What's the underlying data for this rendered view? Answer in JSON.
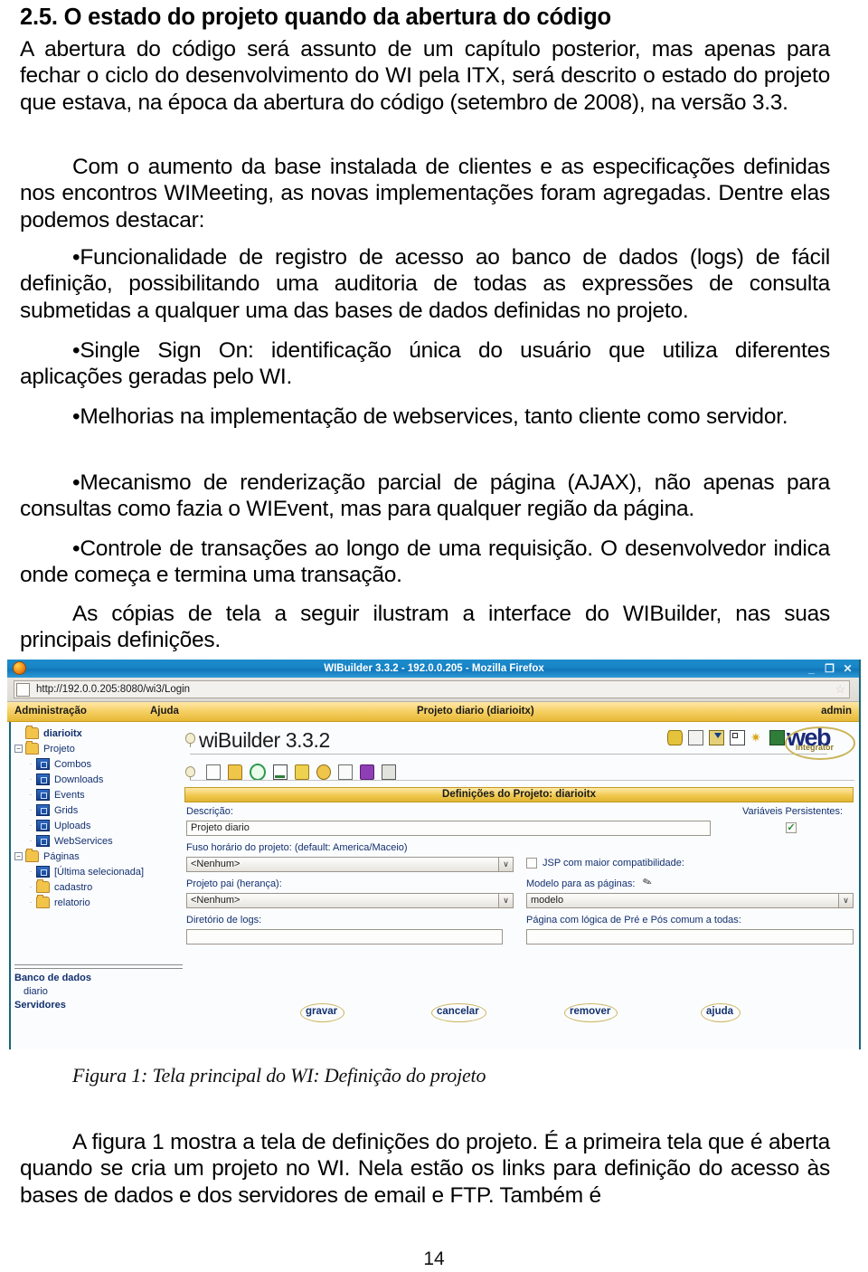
{
  "document": {
    "heading": "2.5. O estado do projeto quando da abertura do código",
    "paragraphs": [
      "A abertura do código será assunto de um capítulo posterior, mas apenas para fechar o ciclo do desenvolvimento do WI pela ITX, será descrito o estado do projeto que estava, na época da abertura do código (setembro de 2008), na versão 3.3.",
      "Com o aumento da base instalada de clientes e as especificações definidas nos encontros WIMeeting, as novas implementações foram agregadas. Dentre elas podemos destacar:"
    ],
    "bullets": [
      "Funcionalidade de registro de acesso ao banco de dados (logs) de fácil definição, possibilitando uma auditoria de todas as expressões de consulta submetidas a qualquer uma das bases de dados definidas no projeto.",
      "Single Sign On: identificação única do usuário que utiliza diferentes aplicações geradas pelo WI.",
      "Melhorias na implementação de webservices, tanto cliente como servidor.",
      "Mecanismo de renderização parcial de página (AJAX), não apenas para consultas como fazia o WIEvent, mas para qualquer região da página.",
      "Controle de transações ao longo de uma requisição. O desenvolvedor indica onde começa e termina uma transação."
    ],
    "para_after_bullets": "As cópias de tela a seguir ilustram a interface do WIBuilder, nas suas principais definições.",
    "figure_caption": "Figura 1: Tela principal do WI: Definição do projeto",
    "para_after_figure": "A figura 1 mostra a tela de definições do projeto. É a primeira tela que é aberta quando se cria um projeto no WI. Nela estão os links para definição do acesso às bases de dados e dos servidores de email e FTP. Também é",
    "page_number": "14"
  },
  "screenshot": {
    "browser": {
      "title": "WIBuilder 3.3.2 - 192.0.0.205 - Mozilla Firefox",
      "favicon": "firefox-icon",
      "window_controls": {
        "minimize": "_",
        "maximize": "❐",
        "close": "✕"
      },
      "url": "http://192.0.0.205:8080/wi3/Login",
      "url_icon": "page-icon",
      "bookmark_icon": "star-icon"
    },
    "menubar": {
      "administracao": "Administração",
      "ajuda": "Ajuda",
      "projeto": "Projeto diario (diarioitx)",
      "user": "admin"
    },
    "tree": {
      "root": "diarioitx",
      "nodes": [
        {
          "label": "Projeto",
          "icon": "folder-icon",
          "expander": "−",
          "level": 1
        },
        {
          "label": "Combos",
          "icon": "page-icon",
          "level": 2
        },
        {
          "label": "Downloads",
          "icon": "page-icon",
          "level": 2
        },
        {
          "label": "Events",
          "icon": "page-icon",
          "level": 2
        },
        {
          "label": "Grids",
          "icon": "page-icon",
          "level": 2
        },
        {
          "label": "Uploads",
          "icon": "page-icon",
          "level": 2
        },
        {
          "label": "WebServices",
          "icon": "page-icon",
          "level": 2
        },
        {
          "label": "Páginas",
          "icon": "folder-icon",
          "expander": "−",
          "level": 1
        },
        {
          "label": "[Última selecionada]",
          "icon": "page-icon",
          "level": 2
        },
        {
          "label": "cadastro",
          "icon": "folder-icon",
          "level": 2
        },
        {
          "label": "relatorio",
          "icon": "folder-icon",
          "level": 2
        }
      ],
      "footer": {
        "banco_de_dados": "Banco de dados",
        "banco_item": "diario",
        "servidores": "Servidores"
      }
    },
    "app": {
      "brand_title": "wiBuilder 3.3.2",
      "logo_main": "web",
      "logo_sub": "integrator",
      "header_icons": [
        "database-icon",
        "document-icon",
        "download-icon",
        "grid-add-icon",
        "tools-icon",
        "exit-icon"
      ],
      "toolbar_icons": [
        "new-file-icon",
        "open-folder-icon",
        "refresh-icon",
        "chart-icon",
        "key-icon",
        "gear-icon",
        "file-icon",
        "book-icon",
        "window-icon"
      ],
      "panel_title": "Definições do Projeto: diarioitx",
      "fields": {
        "descricao_label": "Descrição:",
        "descricao_value": "Projeto diario",
        "fuso_label": "Fuso horário do projeto: (default: America/Maceio)",
        "fuso_value": "<Nenhum>",
        "projeto_pai_label": "Projeto pai (herança):",
        "projeto_pai_value": "<Nenhum>",
        "diretorio_logs_label": "Diretório de logs:",
        "diretorio_logs_value": "",
        "variaveis_label": "Variáveis Persistentes:",
        "variaveis_checked": "✓",
        "jsp_label": "JSP com maior compatibilidade:",
        "modelo_label": "Modelo para as páginas:",
        "modelo_value": "modelo",
        "pagina_logica_label": "Página com lógica de Pré e Pós comum a todas:",
        "pagina_logica_value": ""
      },
      "buttons": {
        "gravar": "gravar",
        "cancelar": "cancelar",
        "remover": "remover",
        "ajuda": "ajuda"
      }
    }
  },
  "colors": {
    "titlebar": "#1784c6",
    "menubar": "#f0c951",
    "tree_text": "#12306e",
    "panel_title": "#f0c951",
    "logo": "#1a2a7a"
  }
}
